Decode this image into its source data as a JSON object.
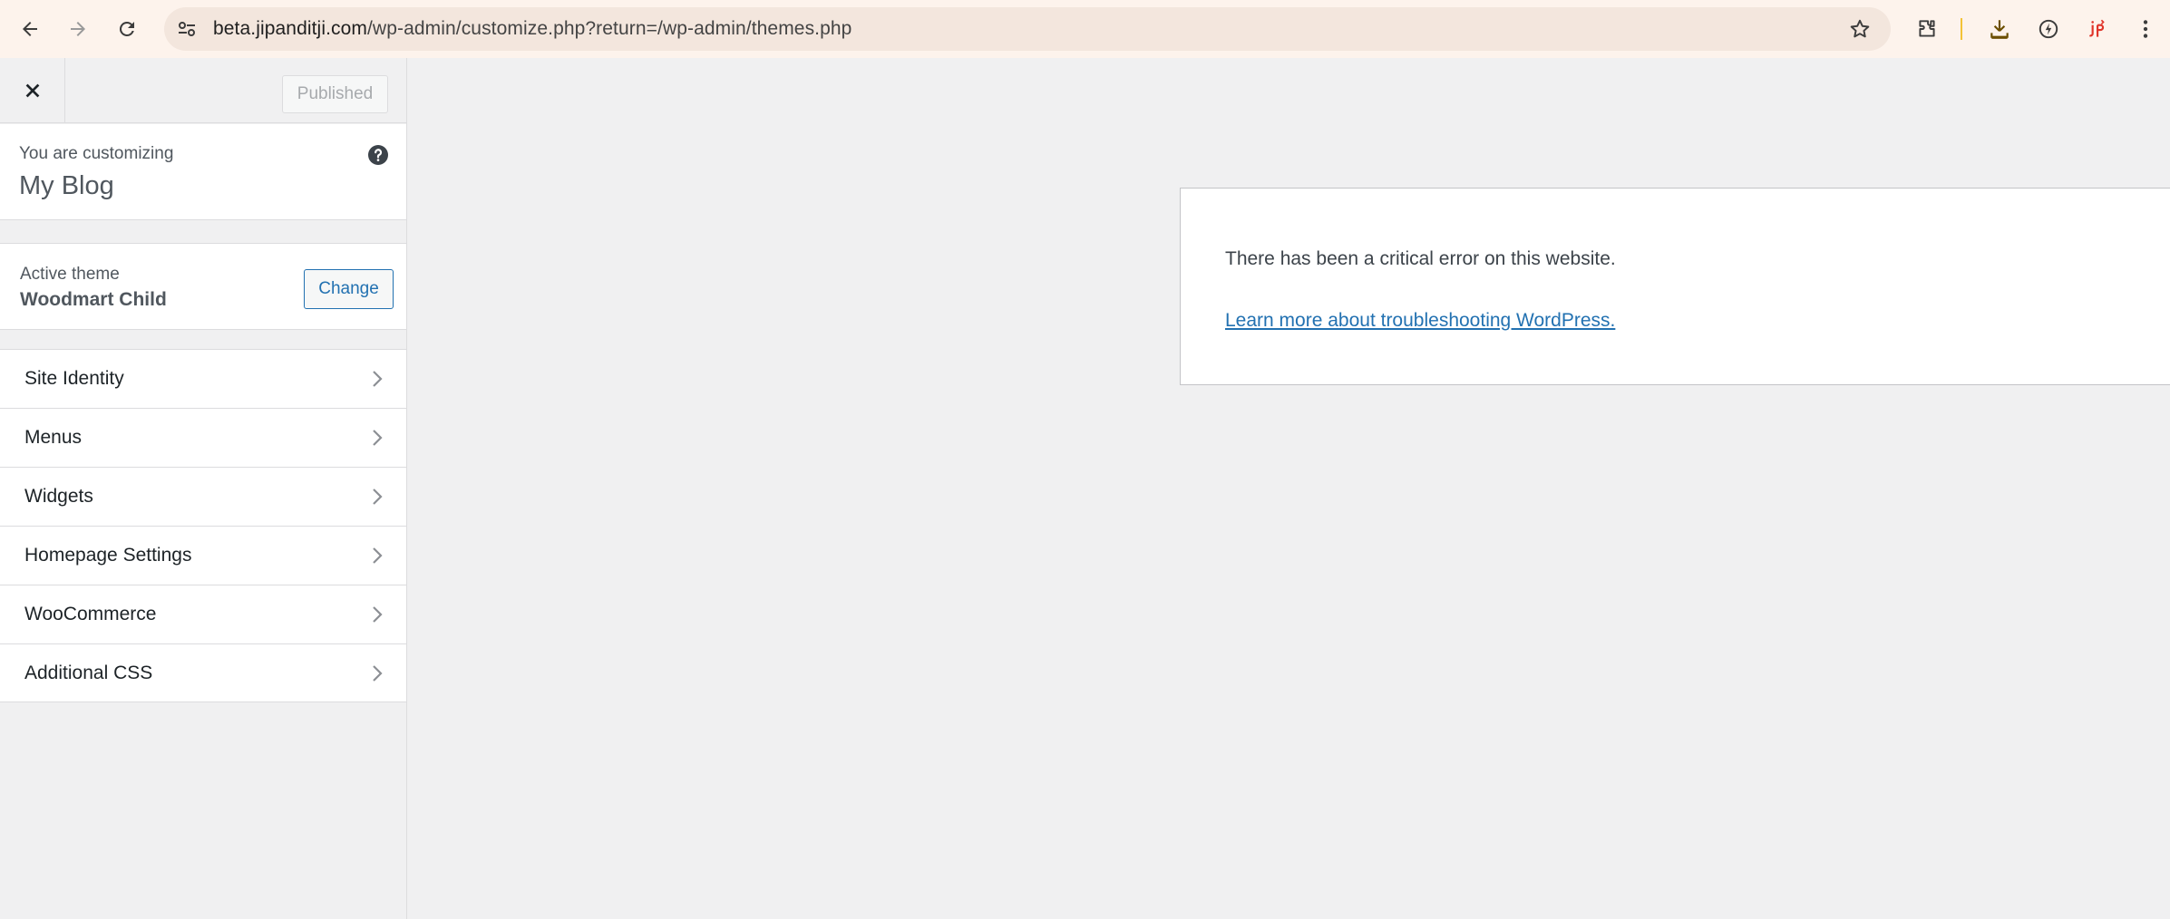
{
  "browser": {
    "url_host": "beta.jipanditji.com",
    "url_path": "/wp-admin/customize.php?return=/wp-admin/themes.php",
    "icons": [
      "back-icon",
      "forward-icon",
      "reload-icon",
      "site-info-icon",
      "bookmark-star-icon",
      "extensions-icon",
      "download-icon",
      "performance-icon",
      "extension-jp-icon",
      "menu-icon"
    ]
  },
  "customizer": {
    "publish_label": "Published",
    "customizing_label": "You are customizing",
    "site_title": "My Blog",
    "active_theme_label": "Active theme",
    "theme_name": "Woodmart Child",
    "change_label": "Change",
    "sections": [
      {
        "label": "Site Identity"
      },
      {
        "label": "Menus"
      },
      {
        "label": "Widgets"
      },
      {
        "label": "Homepage Settings"
      },
      {
        "label": "WooCommerce"
      },
      {
        "label": "Additional CSS"
      }
    ]
  },
  "preview": {
    "error_message": "There has been a critical error on this website.",
    "error_link": "Learn more about troubleshooting WordPress."
  },
  "colors": {
    "accent": "#2271b1",
    "browser_bar": "#fdf3ec",
    "panel_bg": "#f0f0f1"
  }
}
